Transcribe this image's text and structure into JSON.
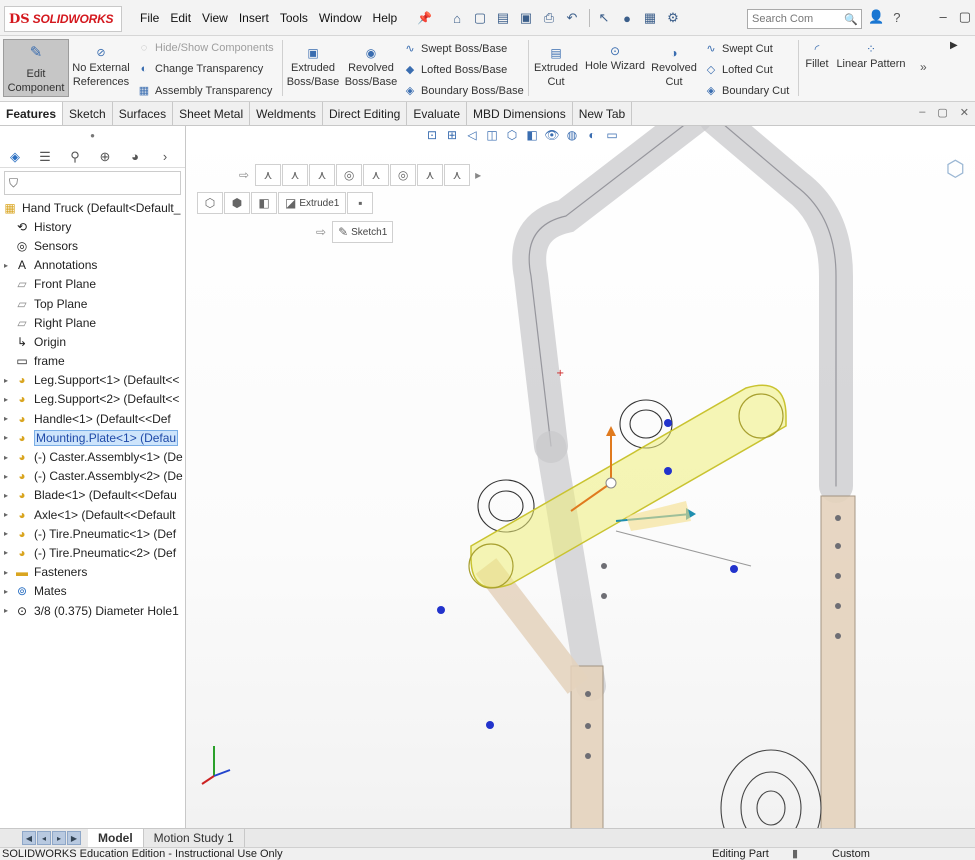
{
  "app": {
    "logo_ds": "DS",
    "logo_name": "SOLIDWORKS"
  },
  "menu": [
    "File",
    "Edit",
    "View",
    "Insert",
    "Tools",
    "Window",
    "Help"
  ],
  "search": {
    "placeholder": "Search Com"
  },
  "ribbon": {
    "edit_component_line1": "Edit",
    "edit_component_line2": "Component",
    "no_external_line1": "No External",
    "no_external_line2": "References",
    "hide_show": "Hide/Show Components",
    "change_transparency": "Change Transparency",
    "assembly_transparency": "Assembly Transparency",
    "extruded_boss_line1": "Extruded",
    "extruded_boss_line2": "Boss/Base",
    "revolved_boss_line1": "Revolved",
    "revolved_boss_line2": "Boss/Base",
    "swept_boss": "Swept Boss/Base",
    "lofted_boss": "Lofted Boss/Base",
    "boundary_boss": "Boundary Boss/Base",
    "extruded_cut_line1": "Extruded",
    "extruded_cut_line2": "Cut",
    "hole_wizard": "Hole Wizard",
    "revolved_cut_line1": "Revolved",
    "revolved_cut_line2": "Cut",
    "swept_cut": "Swept Cut",
    "lofted_cut": "Lofted Cut",
    "boundary_cut": "Boundary Cut",
    "fillet": "Fillet",
    "linear_pattern": "Linear Pattern"
  },
  "tabs": [
    "Features",
    "Sketch",
    "Surfaces",
    "Sheet Metal",
    "Weldments",
    "Direct Editing",
    "Evaluate",
    "MBD Dimensions",
    "New Tab"
  ],
  "tree": {
    "root": "Hand Truck  (Default<Default_",
    "items": [
      {
        "label": "History",
        "icon": "history-icon",
        "expandable": false
      },
      {
        "label": "Sensors",
        "icon": "sensors-icon",
        "expandable": false
      },
      {
        "label": "Annotations",
        "icon": "annotations-icon",
        "expandable": true
      },
      {
        "label": "Front Plane",
        "icon": "plane-icon",
        "expandable": false
      },
      {
        "label": "Top Plane",
        "icon": "plane-icon",
        "expandable": false
      },
      {
        "label": "Right Plane",
        "icon": "plane-icon",
        "expandable": false
      },
      {
        "label": "Origin",
        "icon": "origin-icon",
        "expandable": false
      },
      {
        "label": "frame",
        "icon": "sketch-icon",
        "expandable": false
      },
      {
        "label": "Leg.Support<1> (Default<<",
        "icon": "part-icon",
        "expandable": true
      },
      {
        "label": "Leg.Support<2> (Default<<",
        "icon": "part-icon",
        "expandable": true
      },
      {
        "label": "Handle<1> (Default<<Def",
        "icon": "part-icon",
        "expandable": true
      },
      {
        "label": "Mounting.Plate<1> (Defau",
        "icon": "part-edit-icon",
        "expandable": true,
        "selected": true
      },
      {
        "label": "(-) Caster.Assembly<1> (De",
        "icon": "part-icon",
        "expandable": true
      },
      {
        "label": "(-) Caster.Assembly<2> (De",
        "icon": "part-icon",
        "expandable": true
      },
      {
        "label": "Blade<1> (Default<<Defau",
        "icon": "part-icon",
        "expandable": true
      },
      {
        "label": "Axle<1> (Default<<Default",
        "icon": "part-icon",
        "expandable": true
      },
      {
        "label": "(-) Tire.Pneumatic<1> (Def",
        "icon": "part-icon",
        "expandable": true
      },
      {
        "label": "(-) Tire.Pneumatic<2> (Def",
        "icon": "part-icon",
        "expandable": true
      },
      {
        "label": "Fasteners",
        "icon": "folder-icon",
        "expandable": true
      },
      {
        "label": "Mates",
        "icon": "mates-icon",
        "expandable": true
      },
      {
        "label": "3/8 (0.375) Diameter Hole1",
        "icon": "hole-icon",
        "expandable": true
      }
    ]
  },
  "breadcrumb": {
    "feature": "Extrude1",
    "sketch": "Sketch1"
  },
  "bottom_tabs": [
    "Model",
    "Motion Study 1"
  ],
  "status": {
    "text": "SOLIDWORKS Education Edition - Instructional Use Only",
    "editing": "Editing Part",
    "units": "Custom"
  },
  "colors": {
    "selection": "#e8e870",
    "brand": "#d4181e",
    "accent": "#2a6fc2"
  }
}
